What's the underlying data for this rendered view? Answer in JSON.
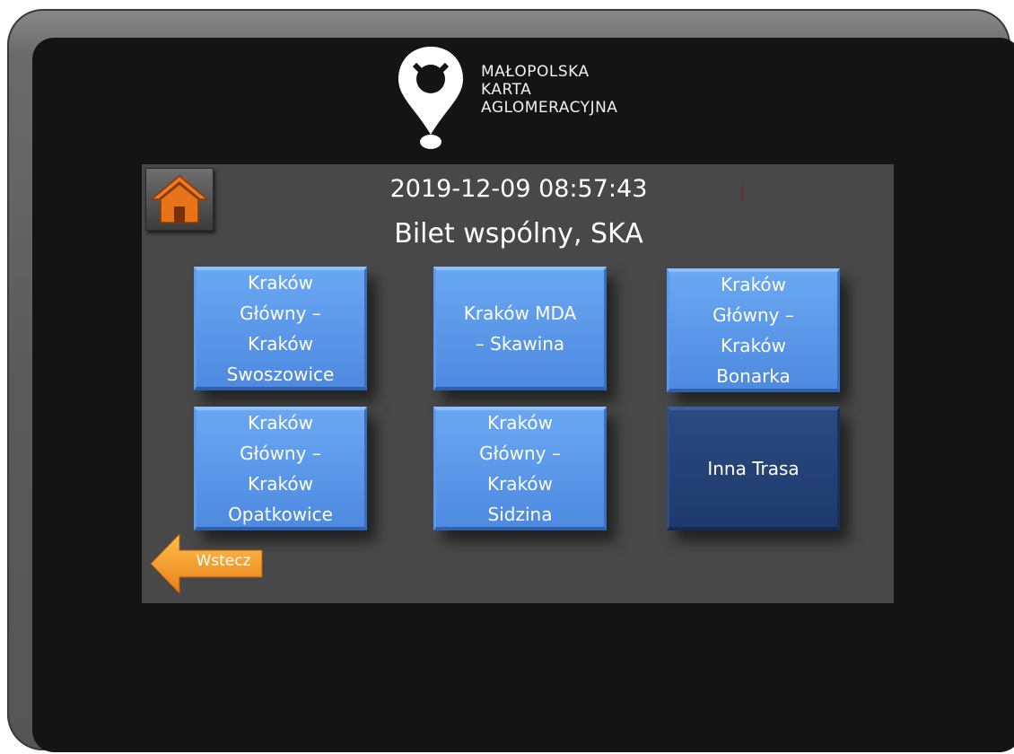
{
  "logo": {
    "lines": [
      "MAŁOPOLSKA",
      "KARTA",
      "AGLOMERACYJNA"
    ]
  },
  "header": {
    "datetime": "2019-12-09 08:57:43",
    "title": "Bilet wspólny, SKA"
  },
  "routes": [
    {
      "label": "Kraków\nGłówny –\nKraków\nSwoszowice"
    },
    {
      "label": "Kraków MDA\n– Skawina"
    },
    {
      "label": "Kraków\nGłówny –\nKraków\nBonarka"
    },
    {
      "label": "Kraków\nGłówny –\nKraków\nOpatkowice"
    },
    {
      "label": "Kraków\nGłówny –\nKraków\nSidzina"
    },
    {
      "label": "Inna Trasa"
    }
  ],
  "nav": {
    "back_label": "Wstecz",
    "home_icon": "home-icon",
    "back_icon": "arrow-left-icon"
  },
  "colors": {
    "button_blue": "#5b97e8",
    "button_dark": "#1e3a6c",
    "panel": "#484848",
    "home_orange": "#e8741a",
    "back_orange": "#f39a1e"
  }
}
